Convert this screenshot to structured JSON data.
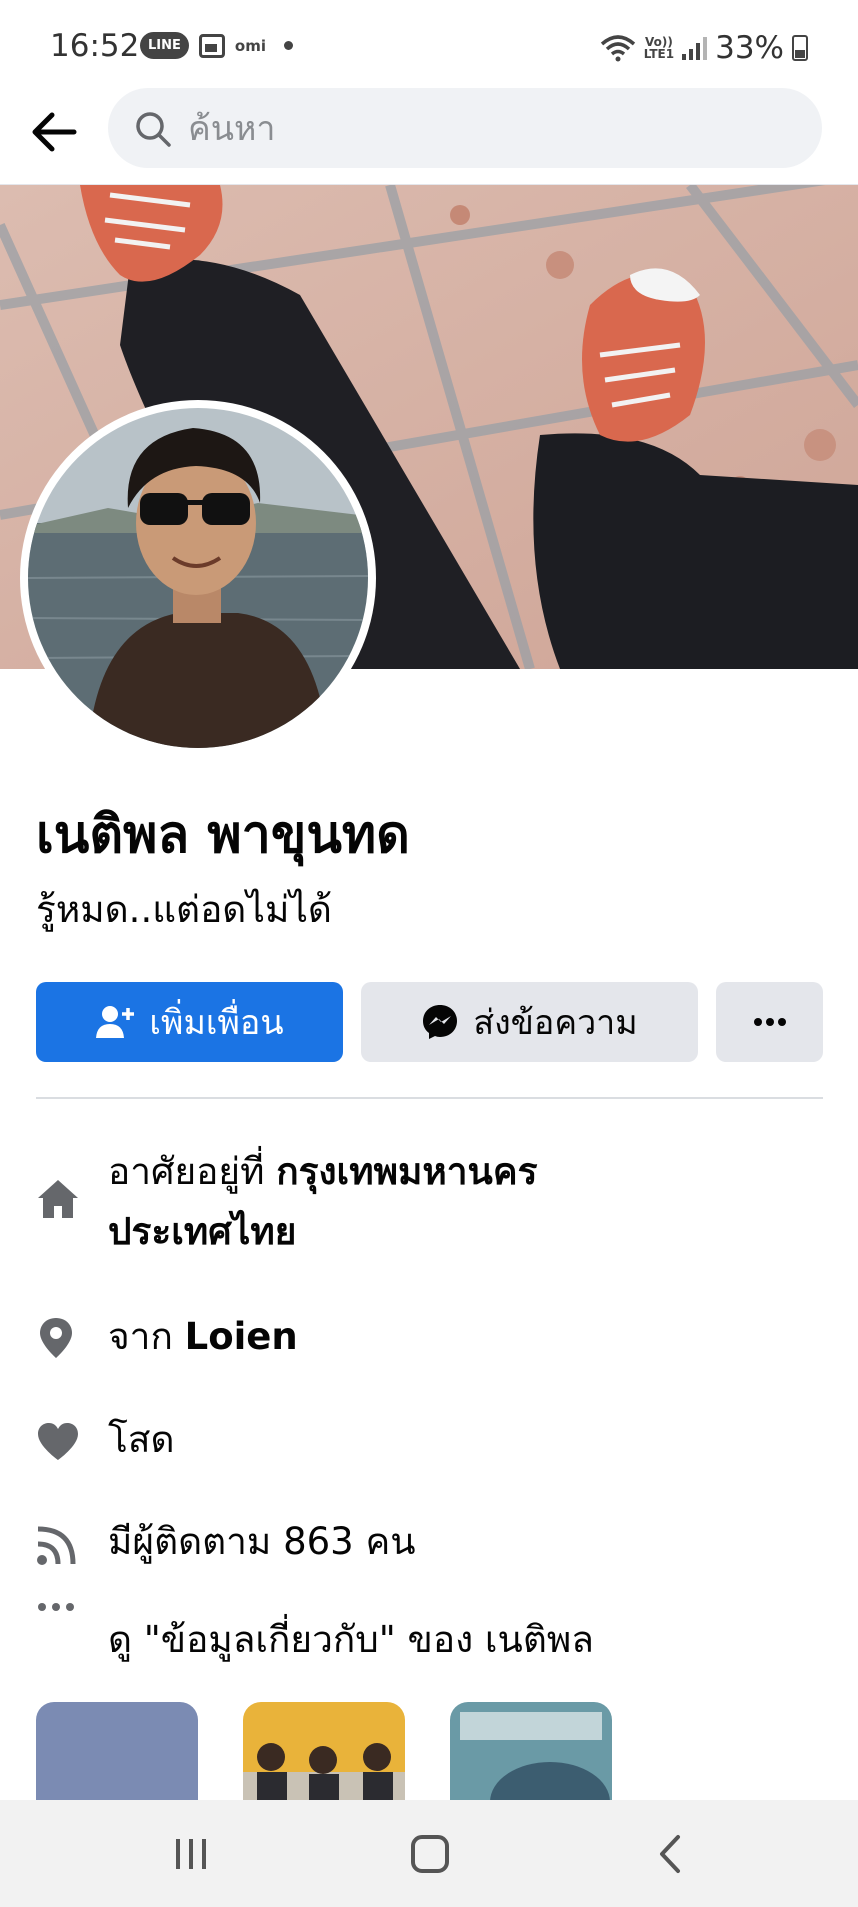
{
  "status_bar": {
    "time": "16:52",
    "line_badge": "LINE",
    "omi_badge": "omi",
    "lte_top": "Vo))",
    "lte_bottom": "LTE1",
    "battery": "33%"
  },
  "search": {
    "placeholder": "ค้นหา"
  },
  "profile": {
    "name": "เนติพล พาขุนทด",
    "bio": "รู้หมด..แต่อดไม่ได้"
  },
  "actions": {
    "add_friend": "เพิ่มเพื่อน",
    "message": "ส่งข้อความ",
    "more": "···"
  },
  "details": {
    "lives_prefix": "อาศัยอยู่ที่ ",
    "lives_city": "กรุงเทพมหานคร",
    "lives_country": "ประเทศไทย",
    "from_prefix": "จาก ",
    "from_place": "Loien",
    "relationship": "โสด",
    "followers": "มีผู้ติดตาม 863 คน",
    "see_about": "ดู \"ข้อมูลเกี่ยวกับ\" ของ เนติพล"
  },
  "colors": {
    "primary": "#1b74e4",
    "secondary_button": "#e4e6eb",
    "icon_gray": "#65676b"
  },
  "icons": {
    "back": "arrow-left-icon",
    "search": "search-icon",
    "add_friend": "add-person-icon",
    "messenger": "messenger-icon",
    "home": "home-icon",
    "location": "pin-icon",
    "heart": "heart-icon",
    "rss": "rss-icon",
    "more": "ellipsis-icon"
  }
}
